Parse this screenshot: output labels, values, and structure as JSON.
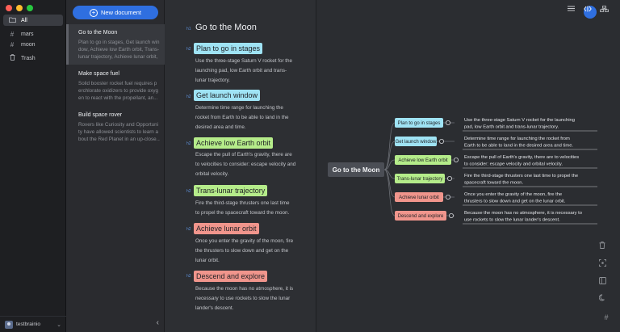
{
  "sidebar": {
    "items": [
      {
        "icon": "folder-icon",
        "label": "All"
      },
      {
        "icon": "hash-icon",
        "label": "mars"
      },
      {
        "icon": "hash-icon",
        "label": "moon"
      },
      {
        "icon": "trash-icon",
        "label": "Trash"
      }
    ],
    "user": {
      "name": "testbrainio"
    }
  },
  "doclist": {
    "new_label": "New document",
    "docs": [
      {
        "title": "Go to the Moon",
        "lines": [
          "Plan to go in stages, Get launch win",
          "dow, Achieve low Earth orbit, Trans-",
          "lunar trajectory, Achieve lunar orbit,"
        ]
      },
      {
        "title": "Make space fuel",
        "lines": [
          "Solid booster rocket fuel requires p",
          "erchlorate oxidizers to provide oxyg",
          "en to react with the propellant, an..."
        ]
      },
      {
        "title": "Build space rover",
        "lines": [
          "Rovers like Curiosity and Opportuni",
          "ty have allowed scientists to learn a",
          "bout the Red Planet in an up-close..."
        ]
      }
    ]
  },
  "editor": {
    "h1_tag": "h1",
    "h2_tag": "h2",
    "title": "Go to the Moon",
    "sections": [
      {
        "heading": "Plan to go in stages",
        "color": "#9fe3f4",
        "lines": [
          "Use the three-stage Saturn V rocket for the",
          "launching pad, low Earth orbit and trans-",
          "lunar trajectory."
        ]
      },
      {
        "heading": "Get launch window",
        "color": "#9fe3f4",
        "lines": [
          "Determine time range for launching the",
          "rocket from Earth to be able to land in the",
          "desired area and time."
        ]
      },
      {
        "heading": "Achieve low Earth orbit",
        "color": "#b5ec8a",
        "lines": [
          "Escape the pull of Earth's gravity, there are",
          "to velocities to consider: escape velocity and",
          "orbital velocity."
        ]
      },
      {
        "heading": "Trans-lunar trajectory",
        "color": "#b5ec8a",
        "lines": [
          "Fire the third-stage thrusters one last time",
          "to propel the spacecraft toward the moon."
        ]
      },
      {
        "heading": "Achieve lunar orbit",
        "color": "#f0958c",
        "lines": [
          "Once you enter the gravity of the moon, fire",
          "the thrusters to slow down and get on the",
          "lunar orbit."
        ]
      },
      {
        "heading": "Descend and explore",
        "color": "#f0958c",
        "lines": [
          "Because the moon has no atmosphere, it is",
          "necessary to use rockets to slow the lunar",
          "lander's descent."
        ]
      }
    ]
  },
  "mindmap": {
    "root": "Go to the Moon",
    "nodes": [
      {
        "label": "Plan to go in stages",
        "color": "#9fe3f4",
        "note": [
          "Use the three-stage Saturn V rocket for the launching",
          "pad, low Earth orbit and trans-lunar trajectory."
        ]
      },
      {
        "label": "Get launch window",
        "color": "#9fe3f4",
        "note": [
          "Determine time range for launching the rocket from",
          "Earth to be able to land in the desired area and time."
        ]
      },
      {
        "label": "Achieve low Earth orbit",
        "color": "#b5ec8a",
        "note": [
          "Escape the pull of Earth's gravity, there are to velocities",
          "to consider: escape velocity and orbital velocity."
        ]
      },
      {
        "label": "Trans-lunar trajectory",
        "color": "#b5ec8a",
        "note": [
          "Fire the third-stage thrusters one last time to propel the",
          "spacecraft toward the moon."
        ]
      },
      {
        "label": "Achieve lunar orbit",
        "color": "#f0958c",
        "note": [
          "Once you enter the gravity of the moon, fire the",
          "thrusters to slow down and get on the lunar orbit."
        ]
      },
      {
        "label": "Descend and explore",
        "color": "#f0958c",
        "note": [
          "Because the moon has no atmosphere, it is necessary to",
          "use rockets to slow the lunar lander's descent."
        ]
      }
    ]
  },
  "colors": {
    "accent": "#2f6fe0",
    "traffic_red": "#ff5f57",
    "traffic_yellow": "#febc2e",
    "traffic_green": "#28c840"
  },
  "toolbar_icons": [
    "menu-icon",
    "code-view-icon",
    "mindmap-view-icon"
  ],
  "side_tools": [
    "trash-icon",
    "focus-icon",
    "sidebar-icon",
    "moon-icon",
    "hash-icon"
  ]
}
